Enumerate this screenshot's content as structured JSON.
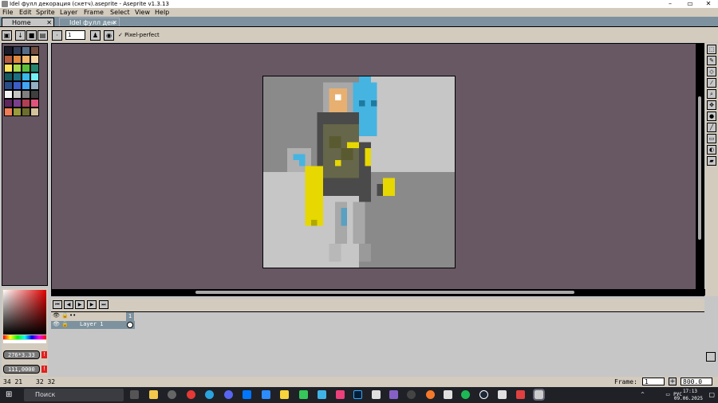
{
  "window": {
    "title": "Idel фулл декорация (скетч).aseprite - Aseprite v1.3.13",
    "minimize": "–",
    "maximize": "▭",
    "close": "✕"
  },
  "menu": [
    "File",
    "Edit",
    "Sprite",
    "Layer",
    "Frame",
    "Select",
    "View",
    "Help"
  ],
  "tabs": {
    "home": "Home",
    "file": "Idel фулл ден",
    "close": "✕"
  },
  "toolbar": {
    "brush_size": "1",
    "pixel_perfect": "Pixel-perfect"
  },
  "palette": {
    "colors": [
      "#1a1c2c",
      "#333c57",
      "#566c86",
      "#734e3f",
      "#b75c3e",
      "#e0893f",
      "#f0b66b",
      "#f6d6a3",
      "#ffe25d",
      "#a7d84d",
      "#5cbf3c",
      "#23846d",
      "#155a5f",
      "#1e6f83",
      "#38b7e8",
      "#73eff7",
      "#294d89",
      "#3b5dc9",
      "#41a6f6",
      "#94b0c2",
      "#f4f4f4",
      "#c4c4c4",
      "#7f7f7f",
      "#3f3f3f",
      "#5d275d",
      "#7b3f8c",
      "#b13e53",
      "#e0547b",
      "#ef7d57",
      "#9b9b3a",
      "#6d6d2e",
      "#d4c29b"
    ]
  },
  "color_panel": {
    "fg_value": "276*3.33",
    "bg_value": "111,0000"
  },
  "timeline": {
    "frame_number": "1",
    "layer_name": "Layer 1"
  },
  "status": {
    "cursor": "34  21",
    "size": "32  32",
    "frame_label": "Frame:",
    "frame_value": "1",
    "zoom_value": "800.0"
  },
  "taskbar": {
    "search": "Поиск",
    "lang": "РУС",
    "time": "17:13",
    "date": "09.06.2025"
  },
  "colors": {
    "editor_bg": "#675863",
    "panel": "#d3cbbe",
    "tabbar": "#7d929e"
  }
}
